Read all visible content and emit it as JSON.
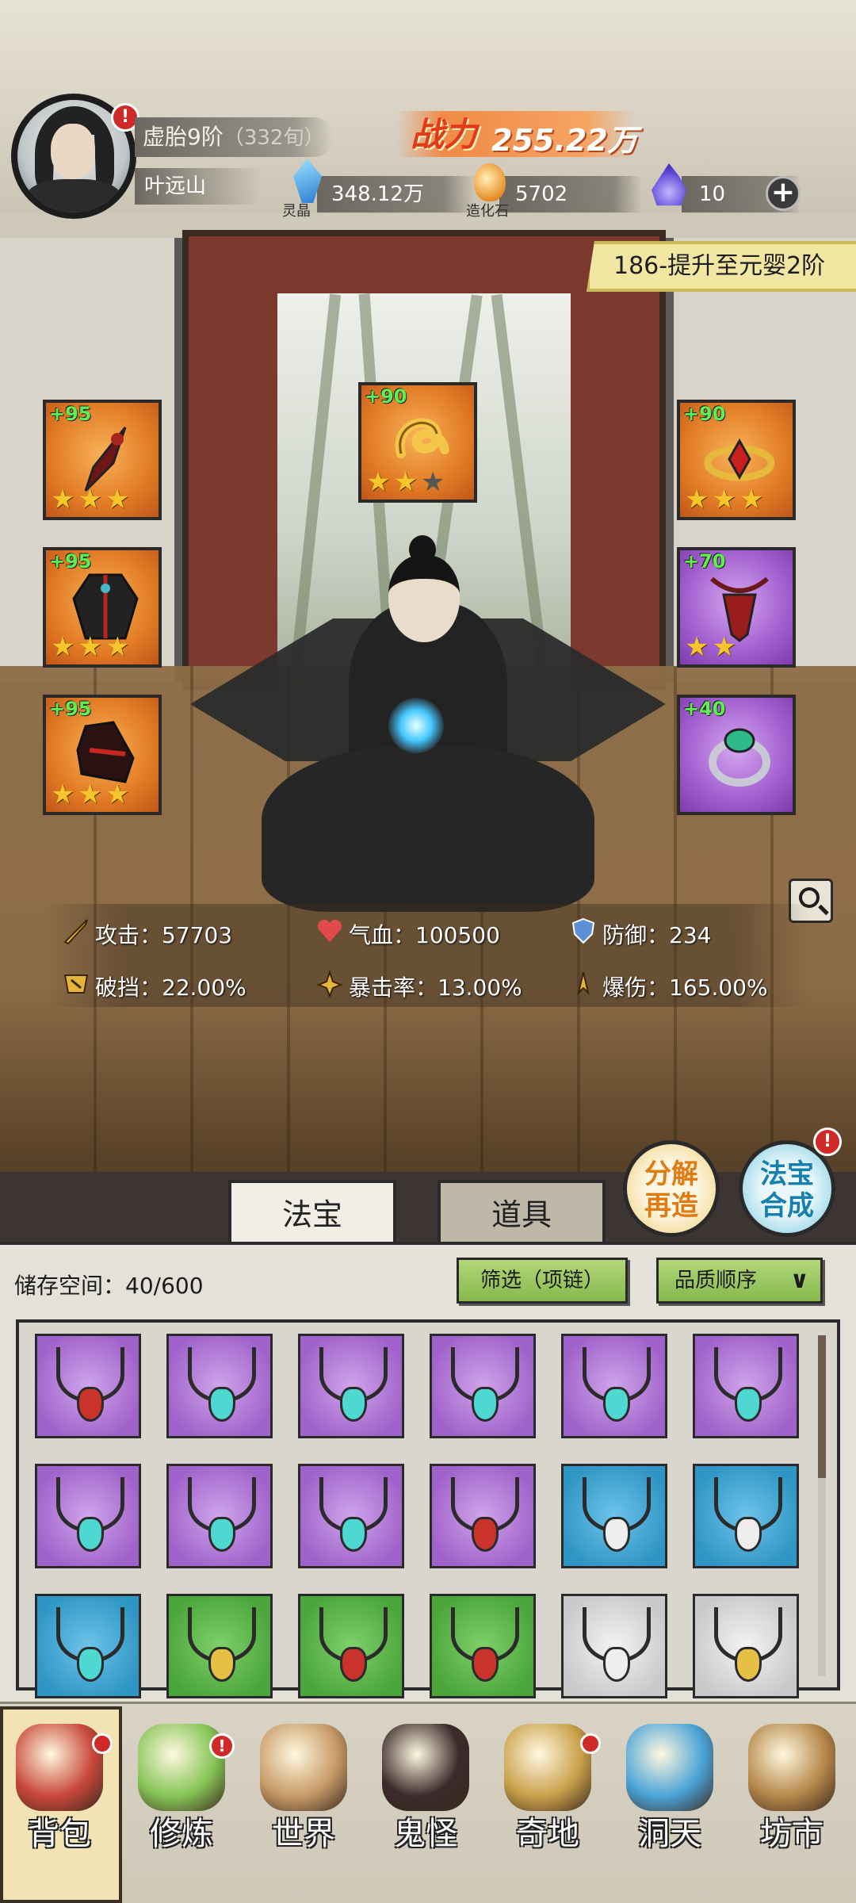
{
  "player": {
    "realm": "虚胎9阶",
    "realm_extra": "（332旬）",
    "name": "叶远山",
    "avatar_badge": "!"
  },
  "power": {
    "label": "战力",
    "value": "255.22万"
  },
  "resources": [
    {
      "icon": "spirit-crystal-icon",
      "caption": "灵晶",
      "value": "348.12万"
    },
    {
      "icon": "creation-stone-icon",
      "caption": "造化石",
      "value": "5702"
    },
    {
      "icon": "purple-flame-icon",
      "caption": "",
      "value": "10"
    }
  ],
  "add_symbol": "+",
  "quest": "186-提升至元婴2阶",
  "equipment": [
    {
      "slot": "weapon",
      "level": "+95",
      "stars": 3,
      "max_stars": 3,
      "rarity": "orange"
    },
    {
      "slot": "artifact",
      "level": "+90",
      "stars": 2,
      "max_stars": 3,
      "rarity": "orange"
    },
    {
      "slot": "crown",
      "level": "+90",
      "stars": 3,
      "max_stars": 3,
      "rarity": "orange"
    },
    {
      "slot": "armor",
      "level": "+95",
      "stars": 3,
      "max_stars": 3,
      "rarity": "orange"
    },
    {
      "slot": "necklace",
      "level": "+70",
      "stars": 2,
      "max_stars": 2,
      "rarity": "purple"
    },
    {
      "slot": "boots",
      "level": "+95",
      "stars": 3,
      "max_stars": 3,
      "rarity": "orange"
    },
    {
      "slot": "ring",
      "level": "+40",
      "stars": 0,
      "max_stars": 0,
      "rarity": "purple"
    }
  ],
  "stats": [
    {
      "icon": "sword-icon",
      "label": "攻击：",
      "value": "57703"
    },
    {
      "icon": "heart-icon",
      "label": "气血：",
      "value": "100500"
    },
    {
      "icon": "shield-icon",
      "label": "防御：",
      "value": "234"
    },
    {
      "icon": "break-icon",
      "label": "破挡：",
      "value": "22.00%"
    },
    {
      "icon": "crit-icon",
      "label": "暴击率：",
      "value": "13.00%"
    },
    {
      "icon": "crit-damage-icon",
      "label": "爆伤：",
      "value": "165.00%"
    }
  ],
  "actions": {
    "decompose": "分解再造",
    "combine": "法宝合成",
    "combine_badge": "!"
  },
  "tabs": [
    {
      "label": "法宝",
      "active": true
    },
    {
      "label": "道具",
      "active": false
    }
  ],
  "inventory": {
    "storage_label": "储存空间：",
    "storage_value": "40/600",
    "filter_label": "筛选（项链）",
    "sort_label": "品质顺序",
    "sort_chevron": "∨",
    "items": [
      {
        "rarity": "purple",
        "gem": "red"
      },
      {
        "rarity": "purple",
        "gem": "teal"
      },
      {
        "rarity": "purple",
        "gem": "teal"
      },
      {
        "rarity": "purple",
        "gem": "teal"
      },
      {
        "rarity": "purple",
        "gem": "teal"
      },
      {
        "rarity": "purple",
        "gem": "teal"
      },
      {
        "rarity": "purple",
        "gem": "teal"
      },
      {
        "rarity": "purple",
        "gem": "teal"
      },
      {
        "rarity": "purple",
        "gem": "teal"
      },
      {
        "rarity": "purple",
        "gem": "red"
      },
      {
        "rarity": "blue",
        "gem": "silver"
      },
      {
        "rarity": "blue",
        "gem": "silver"
      },
      {
        "rarity": "blue",
        "gem": "teal"
      },
      {
        "rarity": "green",
        "gem": "gold"
      },
      {
        "rarity": "green",
        "gem": "red"
      },
      {
        "rarity": "green",
        "gem": "red"
      },
      {
        "rarity": "white",
        "gem": "silver"
      },
      {
        "rarity": "white",
        "gem": "gold"
      }
    ]
  },
  "nav": [
    {
      "label": "背包",
      "icon": "bag-icon",
      "badge": "",
      "active": true
    },
    {
      "label": "修炼",
      "icon": "cultivate-icon",
      "badge": "!",
      "active": false
    },
    {
      "label": "世界",
      "icon": "world-scroll-icon",
      "badge": "",
      "active": false
    },
    {
      "label": "鬼怪",
      "icon": "ghost-egg-icon",
      "badge": "",
      "active": false
    },
    {
      "label": "奇地",
      "icon": "wonderland-icon",
      "badge": "",
      "active": false
    },
    {
      "label": "洞天",
      "icon": "cave-portal-icon",
      "badge": "",
      "active": false
    },
    {
      "label": "坊市",
      "icon": "market-icon",
      "badge": "",
      "active": false
    }
  ],
  "colors": {
    "orange_rarity": "#e27b24",
    "purple_rarity": "#a25fcf",
    "blue_rarity": "#2f95c4",
    "green_rarity": "#4aa53a",
    "level_text": "#5ef050",
    "star": "#f6c52b",
    "badge": "#cf2a27",
    "power_text": "#e33a16"
  }
}
